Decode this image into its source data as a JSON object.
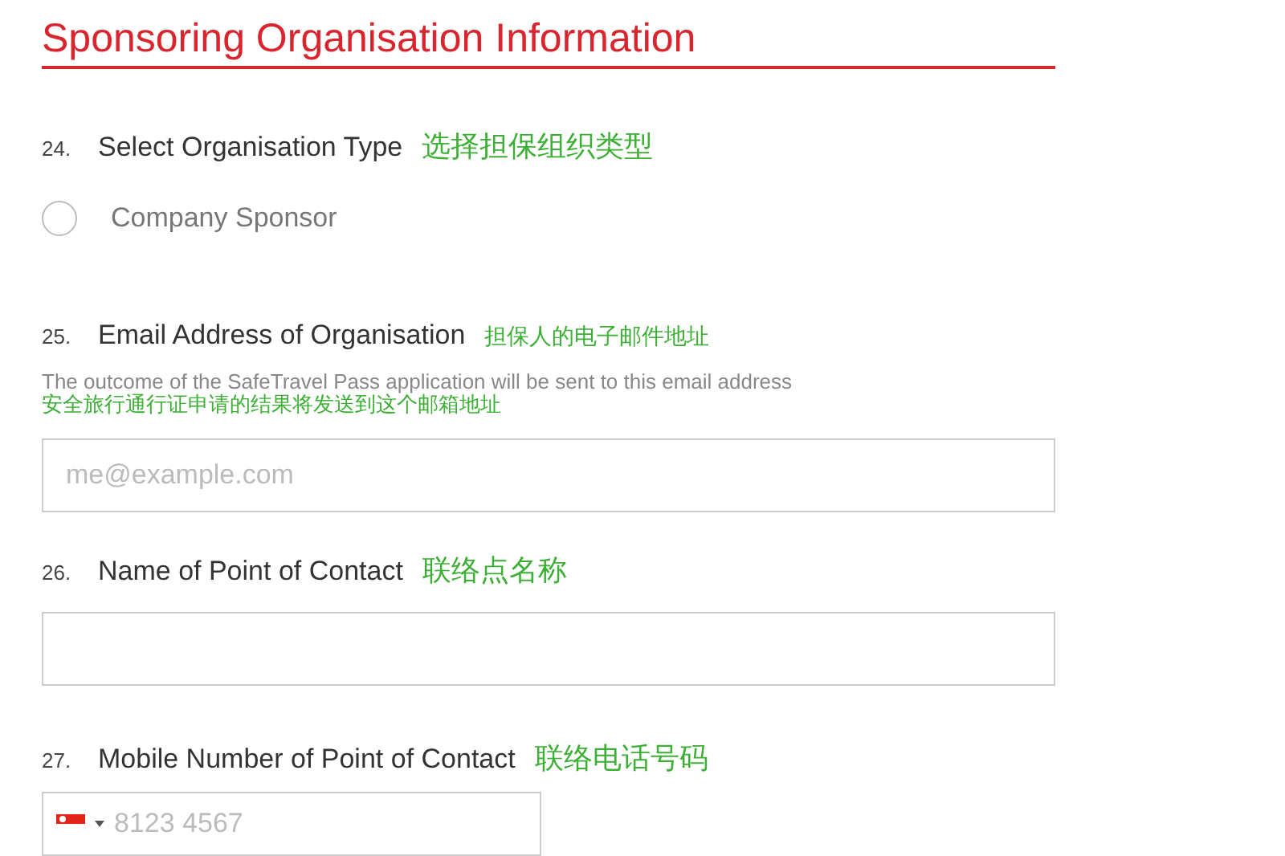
{
  "title": "Sponsoring Organisation Information",
  "questions": [
    {
      "kind": "radio",
      "number": "24.",
      "label": "Select Organisation Type",
      "annotation": "选择担保组织类型",
      "options": [
        {
          "label": "Company Sponsor",
          "selected": false
        }
      ]
    },
    {
      "kind": "text",
      "number": "25.",
      "label": "Email Address of Organisation",
      "annotation": "担保人的电子邮件地址",
      "hint": "The outcome of the SafeTravel Pass application will be sent to this email address",
      "hint_annotation": "安全旅行通行证申请的结果将发送到这个邮箱地址",
      "placeholder": "me@example.com"
    },
    {
      "kind": "text",
      "number": "26.",
      "label": "Name of Point of Contact",
      "annotation": "联络点名称"
    },
    {
      "kind": "phone",
      "number": "27.",
      "label": "Mobile Number of Point of Contact",
      "annotation": "联络电话号码",
      "placeholder": "8123 4567"
    }
  ]
}
